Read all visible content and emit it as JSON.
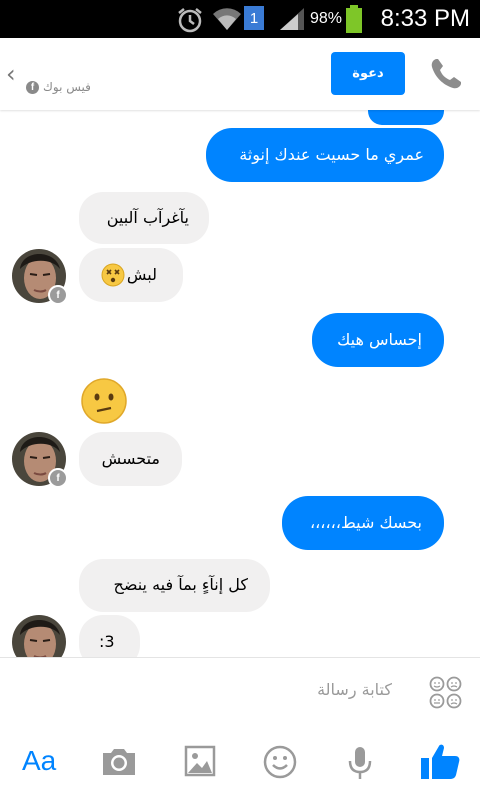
{
  "status_bar": {
    "time": "8:33 PM",
    "battery_percent": "98%",
    "notification_count": "1"
  },
  "header": {
    "source_label": "فيس بوك",
    "invite_label": "دعوة"
  },
  "messages": [
    {
      "direction": "outgoing",
      "text": "عمري ما حسيت عندك إنوثة"
    },
    {
      "direction": "incoming",
      "text": "يآغرآب آلبين"
    },
    {
      "direction": "incoming",
      "text": "لبش"
    },
    {
      "direction": "outgoing",
      "text": "إحساس هيك"
    },
    {
      "direction": "incoming",
      "text": "متحسش"
    },
    {
      "direction": "outgoing",
      "text": "بحسك شيط،،،،،،"
    },
    {
      "direction": "incoming",
      "text": "كل إنآءٍ بمآ فيه ينضح"
    },
    {
      "direction": "incoming",
      "text": ":3"
    }
  ],
  "composer": {
    "placeholder": "كتابة رسالة"
  },
  "toolbar": {
    "text_button_label": "Aa"
  },
  "colors": {
    "accent": "#0084ff",
    "incoming_bubble": "#f1f0f0",
    "emoji": "#f7c843"
  }
}
